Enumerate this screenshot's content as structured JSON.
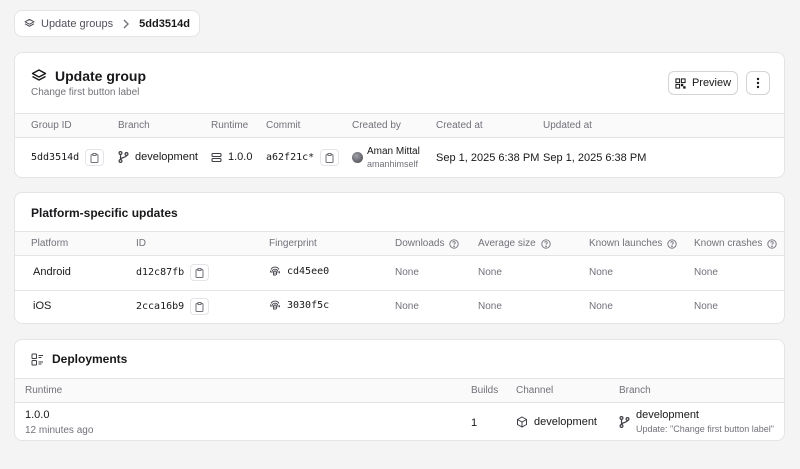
{
  "breadcrumb": {
    "parent": "Update groups",
    "current": "5dd3514d"
  },
  "update_group": {
    "title": "Update group",
    "subtitle": "Change first button label",
    "preview_label": "Preview",
    "columns": [
      "Group ID",
      "Branch",
      "Runtime",
      "Commit",
      "Created by",
      "Created at",
      "Updated at"
    ],
    "row": {
      "group_id": "5dd3514d",
      "branch": "development",
      "runtime": "1.0.0",
      "commit": "a62f21c*",
      "created_by_name": "Aman Mittal",
      "created_by_user": "amanhimself",
      "created_at": "Sep 1, 2025 6:38 PM",
      "updated_at": "Sep 1, 2025 6:38 PM"
    }
  },
  "platform_updates": {
    "title": "Platform-specific updates",
    "columns": [
      "Platform",
      "ID",
      "Fingerprint",
      "Downloads",
      "Average size",
      "Known launches",
      "Known crashes"
    ],
    "rows": [
      {
        "platform": "Android",
        "id": "d12c87fb",
        "fingerprint": "cd45ee0",
        "downloads": "None",
        "avg_size": "None",
        "launches": "None",
        "crashes": "None"
      },
      {
        "platform": "iOS",
        "id": "2cca16b9",
        "fingerprint": "3030f5c",
        "downloads": "None",
        "avg_size": "None",
        "launches": "None",
        "crashes": "None"
      }
    ]
  },
  "deployments": {
    "title": "Deployments",
    "columns": [
      "Runtime",
      "Builds",
      "Channel",
      "Branch"
    ],
    "row": {
      "runtime": "1.0.0",
      "age": "12 minutes ago",
      "builds": "1",
      "channel": "development",
      "branch": "development",
      "update_note": "Update: \"Change first button label\""
    }
  }
}
